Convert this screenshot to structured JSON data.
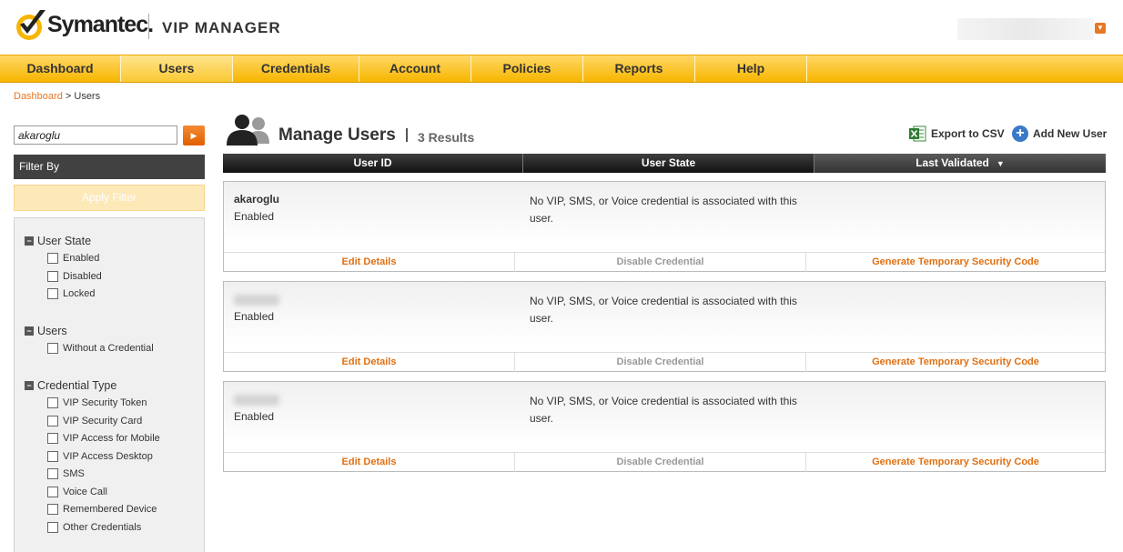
{
  "header": {
    "brand": "Symantec.",
    "product": "VIP MANAGER"
  },
  "nav": [
    "Dashboard",
    "Users",
    "Credentials",
    "Account",
    "Policies",
    "Reports",
    "Help"
  ],
  "nav_active": "Users",
  "breadcrumb": {
    "root": "Dashboard",
    "sep": " > ",
    "current": "Users"
  },
  "sidebar": {
    "search_value": "akaroglu",
    "filter_by": "Filter By",
    "apply_filter": "Apply Filter",
    "groups": [
      {
        "title": "User State",
        "options": [
          "Enabled",
          "Disabled",
          "Locked"
        ]
      },
      {
        "title": "Users",
        "options": [
          "Without a Credential"
        ]
      },
      {
        "title": "Credential Type",
        "options": [
          "VIP Security Token",
          "VIP Security Card",
          "VIP Access for Mobile",
          "VIP Access Desktop",
          "SMS",
          "Voice Call",
          "Remembered Device",
          "Other Credentials"
        ]
      }
    ]
  },
  "main": {
    "title": "Manage Users",
    "results": "3 Results",
    "export_label": "Export to CSV",
    "add_user_label": "Add New User",
    "columns": [
      "User ID",
      "User State",
      "Last Validated"
    ],
    "users": [
      {
        "id": "akaroglu",
        "state": "Enabled",
        "message": "No VIP, SMS, or Voice credential is associated with this user."
      },
      {
        "id": "",
        "state": "Enabled",
        "message": "No VIP, SMS, or Voice credential is associated with this user."
      },
      {
        "id": "",
        "state": "Enabled",
        "message": "No VIP, SMS, or Voice credential is associated with this user."
      }
    ],
    "actions": [
      "Edit Details",
      "Disable Credential",
      "Generate Temporary Security Code"
    ]
  },
  "colors": {
    "accent": "#f7b500",
    "action_orange": "#e07012",
    "header_dark": "#414141"
  }
}
